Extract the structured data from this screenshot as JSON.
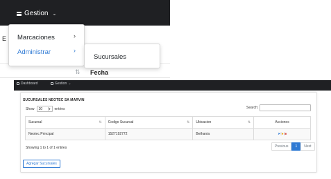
{
  "zoom_view": {
    "nav": {
      "gestion_label": "Gestion",
      "gestion_icon": "menu-icon"
    },
    "background": {
      "partial_text": "E",
      "sort_glyph": "⇅",
      "column_label": "Fecha"
    },
    "dropdown": {
      "items": [
        {
          "label": "Marcaciones",
          "arrow": "›"
        },
        {
          "label": "Administrar",
          "arrow": "›"
        }
      ]
    },
    "submenu": {
      "items": [
        {
          "label": "Sucursales"
        }
      ]
    }
  },
  "page": {
    "nav": {
      "dashboard_label": "Dashboard",
      "gestion_label": "Gestion"
    },
    "card": {
      "title": "SUCURSALES NEOTEC SA MARVIN",
      "show_label": "Show",
      "show_value": "10",
      "entries_label": "entries",
      "search_label": "Search:",
      "search_value": ""
    },
    "table": {
      "headers": [
        "Sucursal",
        "Codigo Sucursal",
        "Ubicacion",
        "Acciones"
      ],
      "rows": [
        {
          "sucursal": "Neotec Principal",
          "codigo": "1527192772",
          "ubicacion": "Bethania"
        }
      ],
      "action_icons": [
        "location-icon",
        "user-icon",
        "delete-icon"
      ]
    },
    "info": "Showing 1 to 1 of 1 entries",
    "pagination": {
      "previous": "Previous",
      "current": "1",
      "next": "Next"
    },
    "add_button": "Agregar Sucursales"
  },
  "colors": {
    "navbar": "#1f2023",
    "accent": "#2f7ad4",
    "danger": "#d9534f",
    "warning": "#f0a500"
  }
}
